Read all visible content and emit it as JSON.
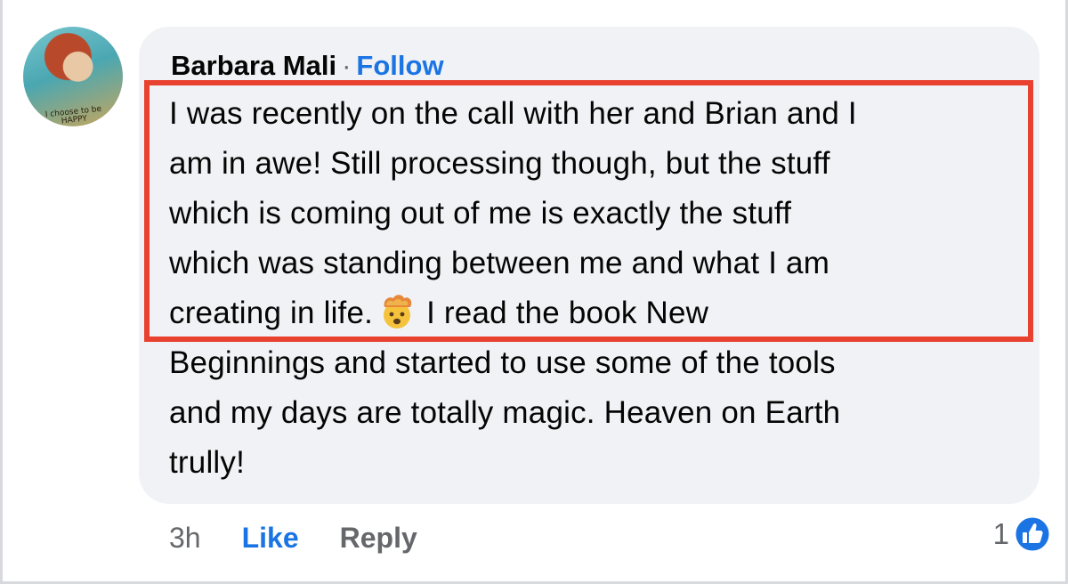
{
  "comment": {
    "author": "Barbara Mali",
    "separator": "·",
    "follow_label": "Follow",
    "avatar_text": "I choose to be HAPPY",
    "text_lines": [
      "I was recently on the call with her and Brian and I",
      "am in awe! Still processing though, but the stuff",
      "which is coming out of me is exactly the stuff",
      "which was standing between me and what I am",
      "Beginnings and started to use some of the tools",
      "and my days are totally magic. Heaven on Earth",
      "trully!"
    ],
    "line5_before_emoji": "creating in life.",
    "line5_after_emoji": "I read the book New",
    "emoji_name": "exploding-head-emoji",
    "timestamp": "3h",
    "like_label": "Like",
    "reply_label": "Reply",
    "reaction_count": "1",
    "reaction_icon": "thumbs-up-icon"
  },
  "colors": {
    "bubble": "#f0f2f5",
    "accent": "#1b74e4",
    "highlight_border": "#e8412f",
    "muted": "#65676b"
  }
}
